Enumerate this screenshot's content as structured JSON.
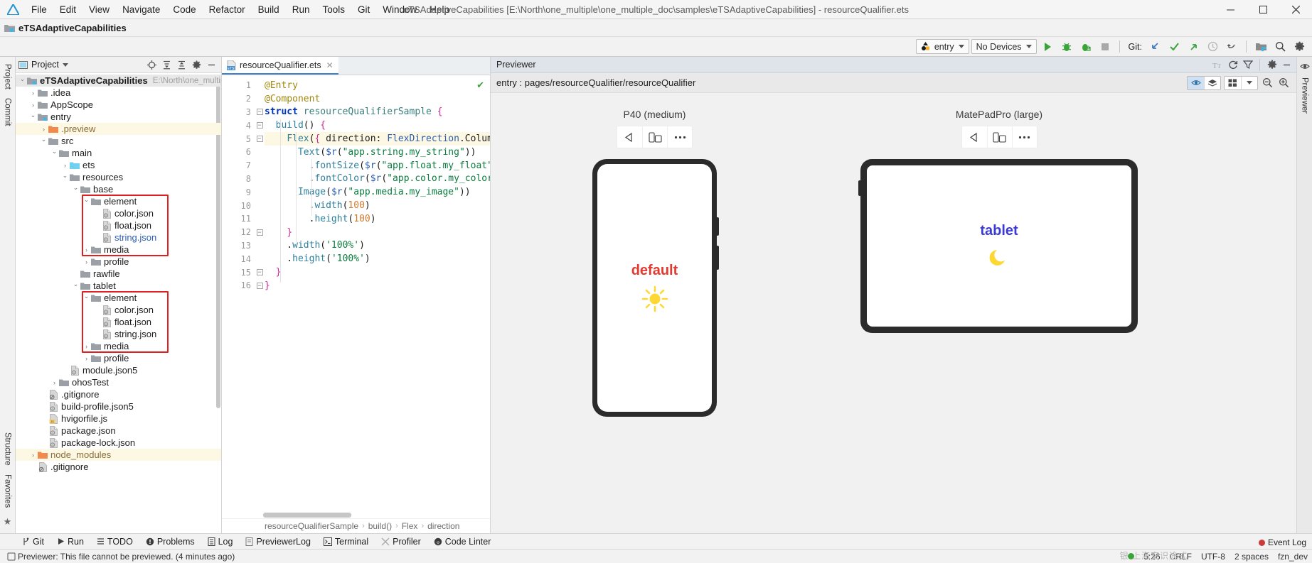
{
  "window": {
    "title": "eTSAdaptiveCapabilities [E:\\North\\one_multiple\\one_multiple_doc\\samples\\eTSAdaptiveCapabilities] - resourceQualifier.ets",
    "minimize": "—",
    "maximize": "□",
    "close": "✕"
  },
  "menu": {
    "items": [
      "File",
      "Edit",
      "View",
      "Navigate",
      "Code",
      "Refactor",
      "Build",
      "Run",
      "Tools",
      "Git",
      "Window",
      "Help"
    ]
  },
  "navbar": {
    "project_name": "eTSAdaptiveCapabilities"
  },
  "toolbar": {
    "run_config": "entry",
    "device": "No Devices",
    "git_label": "Git:"
  },
  "left_strip": {
    "tabs": [
      "Project",
      "Commit",
      "Structure",
      "Favorites"
    ]
  },
  "right_strip": {
    "tabs": [
      "Previewer"
    ]
  },
  "project_panel": {
    "title": "Project",
    "tree": [
      {
        "depth": 0,
        "twist": "⌄",
        "icon": "module-folder",
        "label": "eTSAdaptiveCapabilities",
        "style": "bold",
        "path": "E:\\North\\one_multiple\\on",
        "state": "sel"
      },
      {
        "depth": 1,
        "twist": "›",
        "icon": "folder",
        "label": ".idea",
        "style": ""
      },
      {
        "depth": 1,
        "twist": "›",
        "icon": "folder",
        "label": "AppScope",
        "style": ""
      },
      {
        "depth": 1,
        "twist": "⌄",
        "icon": "module-folder",
        "label": "entry",
        "style": ""
      },
      {
        "depth": 2,
        "twist": "›",
        "icon": "folder-orange",
        "label": ".preview",
        "style": "orange",
        "state": "hl"
      },
      {
        "depth": 2,
        "twist": "⌄",
        "icon": "folder",
        "label": "src",
        "style": ""
      },
      {
        "depth": 3,
        "twist": "⌄",
        "icon": "folder",
        "label": "main",
        "style": ""
      },
      {
        "depth": 4,
        "twist": "›",
        "icon": "folder-blue",
        "label": "ets",
        "style": ""
      },
      {
        "depth": 4,
        "twist": "⌄",
        "icon": "folder",
        "label": "resources",
        "style": ""
      },
      {
        "depth": 5,
        "twist": "⌄",
        "icon": "folder",
        "label": "base",
        "style": ""
      },
      {
        "depth": 6,
        "twist": "⌄",
        "icon": "folder",
        "label": "element",
        "style": ""
      },
      {
        "depth": 7,
        "twist": "",
        "icon": "json-file",
        "label": "color.json",
        "style": ""
      },
      {
        "depth": 7,
        "twist": "",
        "icon": "json-file",
        "label": "float.json",
        "style": ""
      },
      {
        "depth": 7,
        "twist": "",
        "icon": "json-file",
        "label": "string.json",
        "style": "blue"
      },
      {
        "depth": 6,
        "twist": "›",
        "icon": "folder",
        "label": "media",
        "style": ""
      },
      {
        "depth": 6,
        "twist": "›",
        "icon": "folder",
        "label": "profile",
        "style": ""
      },
      {
        "depth": 5,
        "twist": "",
        "icon": "folder",
        "label": "rawfile",
        "style": ""
      },
      {
        "depth": 5,
        "twist": "⌄",
        "icon": "folder",
        "label": "tablet",
        "style": ""
      },
      {
        "depth": 6,
        "twist": "⌄",
        "icon": "folder",
        "label": "element",
        "style": ""
      },
      {
        "depth": 7,
        "twist": "",
        "icon": "json-file",
        "label": "color.json",
        "style": ""
      },
      {
        "depth": 7,
        "twist": "",
        "icon": "json-file",
        "label": "float.json",
        "style": ""
      },
      {
        "depth": 7,
        "twist": "",
        "icon": "json-file",
        "label": "string.json",
        "style": ""
      },
      {
        "depth": 6,
        "twist": "›",
        "icon": "folder",
        "label": "media",
        "style": ""
      },
      {
        "depth": 6,
        "twist": "›",
        "icon": "folder",
        "label": "profile",
        "style": ""
      },
      {
        "depth": 4,
        "twist": "",
        "icon": "json-file",
        "label": "module.json5",
        "style": ""
      },
      {
        "depth": 3,
        "twist": "›",
        "icon": "folder",
        "label": "ohosTest",
        "style": ""
      },
      {
        "depth": 2,
        "twist": "",
        "icon": "gitignore-file",
        "label": ".gitignore",
        "style": ""
      },
      {
        "depth": 2,
        "twist": "",
        "icon": "json-file",
        "label": "build-profile.json5",
        "style": ""
      },
      {
        "depth": 2,
        "twist": "",
        "icon": "js-file",
        "label": "hvigorfile.js",
        "style": ""
      },
      {
        "depth": 2,
        "twist": "",
        "icon": "json-file",
        "label": "package.json",
        "style": ""
      },
      {
        "depth": 2,
        "twist": "",
        "icon": "json-file",
        "label": "package-lock.json",
        "style": ""
      },
      {
        "depth": 1,
        "twist": "›",
        "icon": "folder-orange",
        "label": "node_modules",
        "style": "orange",
        "state": "hl"
      },
      {
        "depth": 1,
        "twist": "",
        "icon": "gitignore-file",
        "label": ".gitignore",
        "style": ""
      }
    ]
  },
  "editor": {
    "tab_label": "resourceQualifier.ets",
    "tab_close": "✕",
    "status_check": "✔",
    "lines": [
      {
        "n": 1,
        "fold": "",
        "cur": false,
        "tokens": [
          {
            "t": "@Entry",
            "c": "k-dec"
          }
        ]
      },
      {
        "n": 2,
        "fold": "",
        "cur": false,
        "tokens": [
          {
            "t": "@Component",
            "c": "k-dec"
          }
        ]
      },
      {
        "n": 3,
        "fold": "-",
        "cur": false,
        "tokens": [
          {
            "t": "struct ",
            "c": "k-kw"
          },
          {
            "t": "resourceQualifierSample ",
            "c": "k-cls"
          },
          {
            "t": "{",
            "c": "k-brc"
          }
        ]
      },
      {
        "n": 4,
        "fold": "-",
        "cur": false,
        "tokens": [
          {
            "t": "  ",
            "c": "k-pl"
          },
          {
            "t": "build",
            "c": "k-fn"
          },
          {
            "t": "() ",
            "c": "k-pl"
          },
          {
            "t": "{",
            "c": "k-brc"
          }
        ]
      },
      {
        "n": 5,
        "fold": "-",
        "cur": true,
        "tokens": [
          {
            "t": "    ",
            "c": "k-pl"
          },
          {
            "t": "Flex",
            "c": "k-fn"
          },
          {
            "t": "(",
            "c": "k-pl"
          },
          {
            "t": "{",
            "c": "k-brc"
          },
          {
            "t": " direction: ",
            "c": "k-pl"
          },
          {
            "t": "FlexDirection",
            "c": "k-prop"
          },
          {
            "t": ".Column, ali",
            "c": "k-pl"
          }
        ]
      },
      {
        "n": 6,
        "fold": "",
        "cur": false,
        "tokens": [
          {
            "t": "      ",
            "c": "k-pl"
          },
          {
            "t": "Text",
            "c": "k-fn"
          },
          {
            "t": "(",
            "c": "k-pl"
          },
          {
            "t": "$r",
            "c": "k-prop"
          },
          {
            "t": "(",
            "c": "k-pl"
          },
          {
            "t": "\"app.string.my_string\"",
            "c": "k-str"
          },
          {
            "t": "))",
            "c": "k-pl"
          }
        ]
      },
      {
        "n": 7,
        "fold": "",
        "cur": false,
        "tokens": [
          {
            "t": "        .",
            "c": "k-pl"
          },
          {
            "t": "fontSize",
            "c": "k-fn"
          },
          {
            "t": "(",
            "c": "k-pl"
          },
          {
            "t": "$r",
            "c": "k-prop"
          },
          {
            "t": "(",
            "c": "k-pl"
          },
          {
            "t": "\"app.float.my_float\"",
            "c": "k-str"
          },
          {
            "t": "))",
            "c": "k-pl"
          }
        ]
      },
      {
        "n": 8,
        "fold": "",
        "cur": false,
        "tokens": [
          {
            "t": "        .",
            "c": "k-pl"
          },
          {
            "t": "fontColor",
            "c": "k-fn"
          },
          {
            "t": "(",
            "c": "k-pl"
          },
          {
            "t": "$r",
            "c": "k-prop"
          },
          {
            "t": "(",
            "c": "k-pl"
          },
          {
            "t": "\"app.color.my_color\"",
            "c": "k-str"
          },
          {
            "t": "))",
            "c": "k-pl"
          }
        ]
      },
      {
        "n": 9,
        "fold": "",
        "cur": false,
        "tokens": [
          {
            "t": "      ",
            "c": "k-pl"
          },
          {
            "t": "Image",
            "c": "k-fn"
          },
          {
            "t": "(",
            "c": "k-pl"
          },
          {
            "t": "$r",
            "c": "k-prop"
          },
          {
            "t": "(",
            "c": "k-pl"
          },
          {
            "t": "\"app.media.my_image\"",
            "c": "k-str"
          },
          {
            "t": "))",
            "c": "k-pl"
          }
        ]
      },
      {
        "n": 10,
        "fold": "",
        "cur": false,
        "tokens": [
          {
            "t": "        .",
            "c": "k-pl"
          },
          {
            "t": "width",
            "c": "k-fn"
          },
          {
            "t": "(",
            "c": "k-pl"
          },
          {
            "t": "100",
            "c": "k-num"
          },
          {
            "t": ")",
            "c": "k-pl"
          }
        ]
      },
      {
        "n": 11,
        "fold": "",
        "cur": false,
        "tokens": [
          {
            "t": "        .",
            "c": "k-pl"
          },
          {
            "t": "height",
            "c": "k-fn"
          },
          {
            "t": "(",
            "c": "k-pl"
          },
          {
            "t": "100",
            "c": "k-num"
          },
          {
            "t": ")",
            "c": "k-pl"
          }
        ]
      },
      {
        "n": 12,
        "fold": "-",
        "cur": false,
        "tokens": [
          {
            "t": "    ",
            "c": "k-pl"
          },
          {
            "t": "}",
            "c": "k-brc"
          }
        ]
      },
      {
        "n": 13,
        "fold": "",
        "cur": false,
        "tokens": [
          {
            "t": "    .",
            "c": "k-pl"
          },
          {
            "t": "width",
            "c": "k-fn"
          },
          {
            "t": "(",
            "c": "k-pl"
          },
          {
            "t": "'100%'",
            "c": "k-str"
          },
          {
            "t": ")",
            "c": "k-pl"
          }
        ]
      },
      {
        "n": 14,
        "fold": "",
        "cur": false,
        "tokens": [
          {
            "t": "    .",
            "c": "k-pl"
          },
          {
            "t": "height",
            "c": "k-fn"
          },
          {
            "t": "(",
            "c": "k-pl"
          },
          {
            "t": "'100%'",
            "c": "k-str"
          },
          {
            "t": ")",
            "c": "k-pl"
          }
        ]
      },
      {
        "n": 15,
        "fold": "-",
        "cur": false,
        "tokens": [
          {
            "t": "  ",
            "c": "k-pl"
          },
          {
            "t": "}",
            "c": "k-brc"
          }
        ]
      },
      {
        "n": 16,
        "fold": "-",
        "cur": false,
        "tokens": [
          {
            "t": "}",
            "c": "k-brc"
          }
        ]
      }
    ],
    "breadcrumb": [
      "resourceQualifierSample",
      "build()",
      "Flex",
      "direction"
    ],
    "breadcrumb_sep": "›"
  },
  "previewer": {
    "title": "Previewer",
    "route": "entry : pages/resourceQualifier/resourceQualifier",
    "devices": [
      {
        "name": "P40 (medium)",
        "screen_text": "default",
        "screen_icon": "sun-icon",
        "type": "phone"
      },
      {
        "name": "MatePadPro (large)",
        "screen_text": "tablet",
        "screen_icon": "moon-icon",
        "type": "tablet"
      }
    ],
    "device_tools": [
      "rotate-icon",
      "multi-device-icon",
      "more-icon"
    ]
  },
  "tool_windows": [
    {
      "label": "Git",
      "icon": "branch-icon"
    },
    {
      "label": "Run",
      "icon": "play-icon"
    },
    {
      "label": "TODO",
      "icon": "list-icon"
    },
    {
      "label": "Problems",
      "icon": "error-icon"
    },
    {
      "label": "Log",
      "icon": "log-icon"
    },
    {
      "label": "PreviewerLog",
      "icon": "note-icon"
    },
    {
      "label": "Terminal",
      "icon": "terminal-icon"
    },
    {
      "label": "Profiler",
      "icon": "profiler-icon"
    },
    {
      "label": "Code Linter",
      "icon": "linter-icon"
    }
  ],
  "statusbar": {
    "message": "Previewer: This file cannot be previewed. (4 minutes ago)",
    "caret": "5:26",
    "line_sep": "CRLF",
    "encoding": "UTF-8",
    "indent": "2 spaces",
    "branch": "fzn_dev",
    "event_log": "Event Log"
  },
  "watermark": "银 上海安识途式"
}
